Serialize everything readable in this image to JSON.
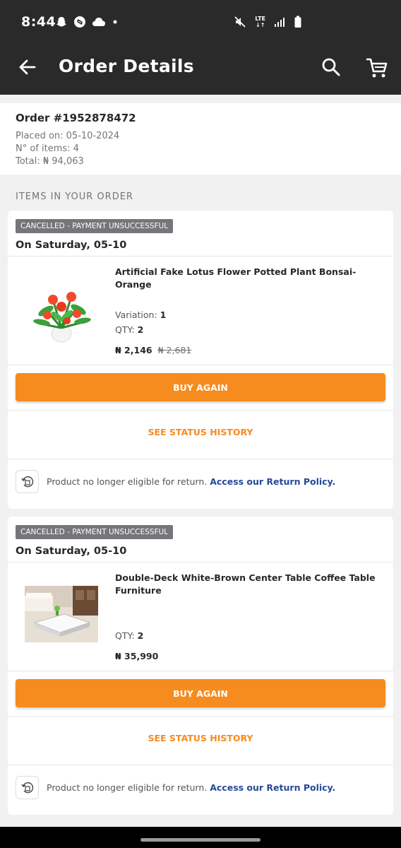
{
  "status_bar": {
    "time": "8:44",
    "left_icons": [
      "snapchat-icon",
      "shazam-icon",
      "cloud-icon",
      "dot-icon"
    ],
    "right_icons": [
      "mute-icon",
      "lte-icon",
      "signal-icon",
      "battery-icon"
    ],
    "network_label": "LTE"
  },
  "app_bar": {
    "title": "Order Details",
    "icons": [
      "back-arrow-icon",
      "search-icon",
      "cart-icon"
    ]
  },
  "order": {
    "number": "Order #1952878472",
    "placed_on": "Placed on: 05-10-2024",
    "items_count": "N° of items: 4",
    "total": "Total: ₦ 94,063"
  },
  "section_title": "ITEMS IN YOUR ORDER",
  "items": [
    {
      "badge": "CANCELLED - PAYMENT UNSUCCESSFUL",
      "date": "On Saturday, 05-10",
      "name": "Artificial Fake Lotus Flower Potted Plant Bonsai-Orange",
      "variation_label": "Variation:",
      "variation_value": "1",
      "qty_label": "QTY:",
      "qty_value": "2",
      "price": "₦ 2,146",
      "old_price": "₦ 2,681",
      "buy_again": "BUY AGAIN",
      "status_history": "SEE STATUS HISTORY",
      "return_text": "Product no longer eligible for return.",
      "return_link": "Access our Return Policy."
    },
    {
      "badge": "CANCELLED - PAYMENT UNSUCCESSFUL",
      "date": "On Saturday, 05-10",
      "name": "Double-Deck White-Brown Center Table Coffee Table Furniture",
      "qty_label": "QTY:",
      "qty_value": "2",
      "price": "₦ 35,990",
      "buy_again": "BUY AGAIN",
      "status_history": "SEE STATUS HISTORY",
      "return_text": "Product no longer eligible for return.",
      "return_link": "Access our Return Policy."
    }
  ],
  "colors": {
    "accent": "#f68b1e",
    "app_bar": "#2a2a2a",
    "badge": "#75757a",
    "link": "#264996"
  }
}
